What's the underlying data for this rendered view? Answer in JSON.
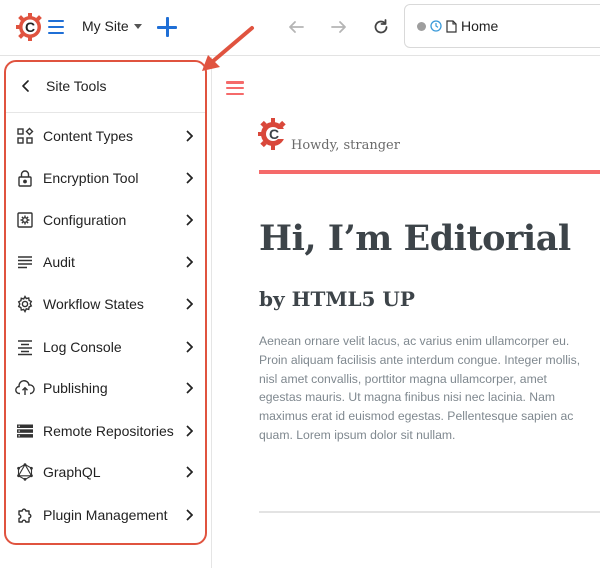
{
  "topbar": {
    "site_name": "My Site",
    "url_label": "Home"
  },
  "sidebar": {
    "title": "Site Tools",
    "items": [
      {
        "label": "Content Types",
        "icon": "content-types-icon"
      },
      {
        "label": "Encryption Tool",
        "icon": "lock-icon"
      },
      {
        "label": "Configuration",
        "icon": "config-gear-box-icon"
      },
      {
        "label": "Audit",
        "icon": "list-lines-icon"
      },
      {
        "label": "Workflow States",
        "icon": "gear-icon"
      },
      {
        "label": "Log Console",
        "icon": "align-center-lines-icon"
      },
      {
        "label": "Publishing",
        "icon": "cloud-upload-icon"
      },
      {
        "label": "Remote Repositories",
        "icon": "storage-icon"
      },
      {
        "label": "GraphQL",
        "icon": "graphql-icon"
      },
      {
        "label": "Plugin Management",
        "icon": "puzzle-icon"
      }
    ]
  },
  "preview": {
    "greeting": "Howdy, stranger",
    "heading": "Hi, I’m Editorial",
    "subheading": "by HTML5 UP",
    "body": "Aenean ornare velit lacus, ac varius enim ullamcorper eu. Proin aliquam facilisis ante interdum congue. Integer mollis, nisl amet convallis, porttitor magna ullamcorper, amet egestas mauris. Ut magna finibus nisi nec lacinia. Nam maximus erat id euismod egestas. Pellentesque sapien ac quam. Lorem ipsum dolor sit nullam."
  },
  "colors": {
    "brand_red": "#e0533f",
    "accent_blue": "#1f6fd6",
    "editorial_red": "#f56a6a",
    "heading_dark": "#3d4449"
  }
}
